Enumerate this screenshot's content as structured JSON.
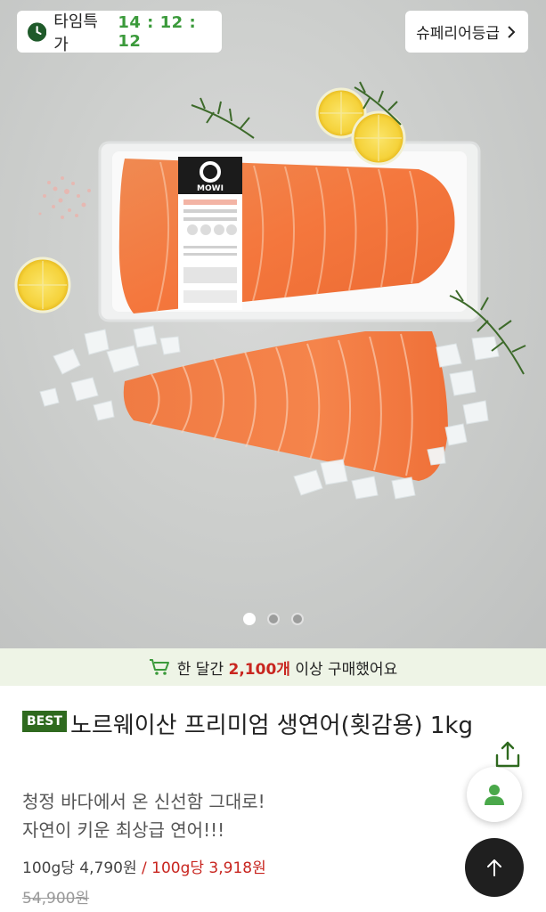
{
  "timer": {
    "label": "타임특가",
    "time": "14 : 12 : 12"
  },
  "grade_button": {
    "label": "슈페리어등급"
  },
  "carousel": {
    "total": 3,
    "active_index": 0
  },
  "package_label": {
    "brand": "MOWI"
  },
  "purchase_banner": {
    "prefix": "한 달간 ",
    "count": "2,100개",
    "suffix": " 이상 구매했어요"
  },
  "product": {
    "badge": "BEST",
    "title": "노르웨이산 프리미엄 생연어(횟감용) 1kg",
    "subtitle_line1": "청정 바다에서 온 신선함 그대로!",
    "subtitle_line2": "자연이 키운 최상급 연어!!!",
    "unit_price_regular": "100g당 4,790원",
    "separator": " / ",
    "unit_price_sale": "100g당 3,918원",
    "original_price": "54,900원"
  },
  "colors": {
    "brand_green": "#3b9a3b",
    "badge_green": "#2f6a1f",
    "sale_red": "#c8251f",
    "banner_bg": "#eef4e6"
  }
}
